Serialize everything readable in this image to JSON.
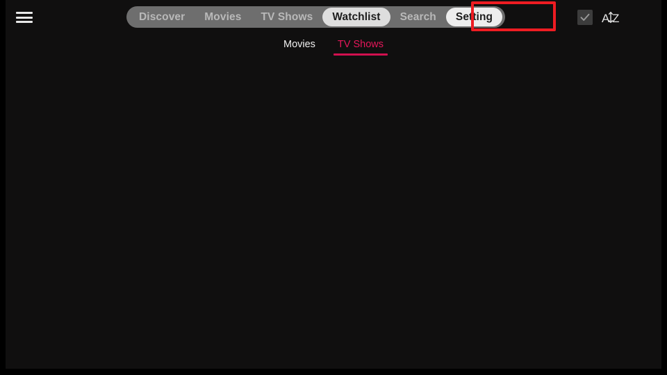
{
  "app": {
    "background_color": "#100f0f",
    "accent_color": "#e5175a",
    "highlight_color": "#ee1c22"
  },
  "top_bar": {
    "menu_icon": "hamburger-menu-icon",
    "nav_pill": {
      "items": [
        {
          "label": "Discover",
          "state": "normal"
        },
        {
          "label": "Movies",
          "state": "normal"
        },
        {
          "label": "TV Shows",
          "state": "normal"
        },
        {
          "label": "Watchlist",
          "state": "selected"
        },
        {
          "label": "Search",
          "state": "normal"
        },
        {
          "label": "Setting",
          "state": "focused"
        }
      ]
    },
    "actions": {
      "select_all_icon": "checkbox-checked-icon",
      "sort_icon": "sort-alphabetical-az-icon",
      "sort_icon_label_top": "A",
      "sort_icon_label_bottom": "Z"
    }
  },
  "sub_tabs": {
    "items": [
      {
        "label": "Movies",
        "active": false
      },
      {
        "label": "TV Shows",
        "active": true
      }
    ]
  },
  "content": {
    "empty_message": ""
  }
}
